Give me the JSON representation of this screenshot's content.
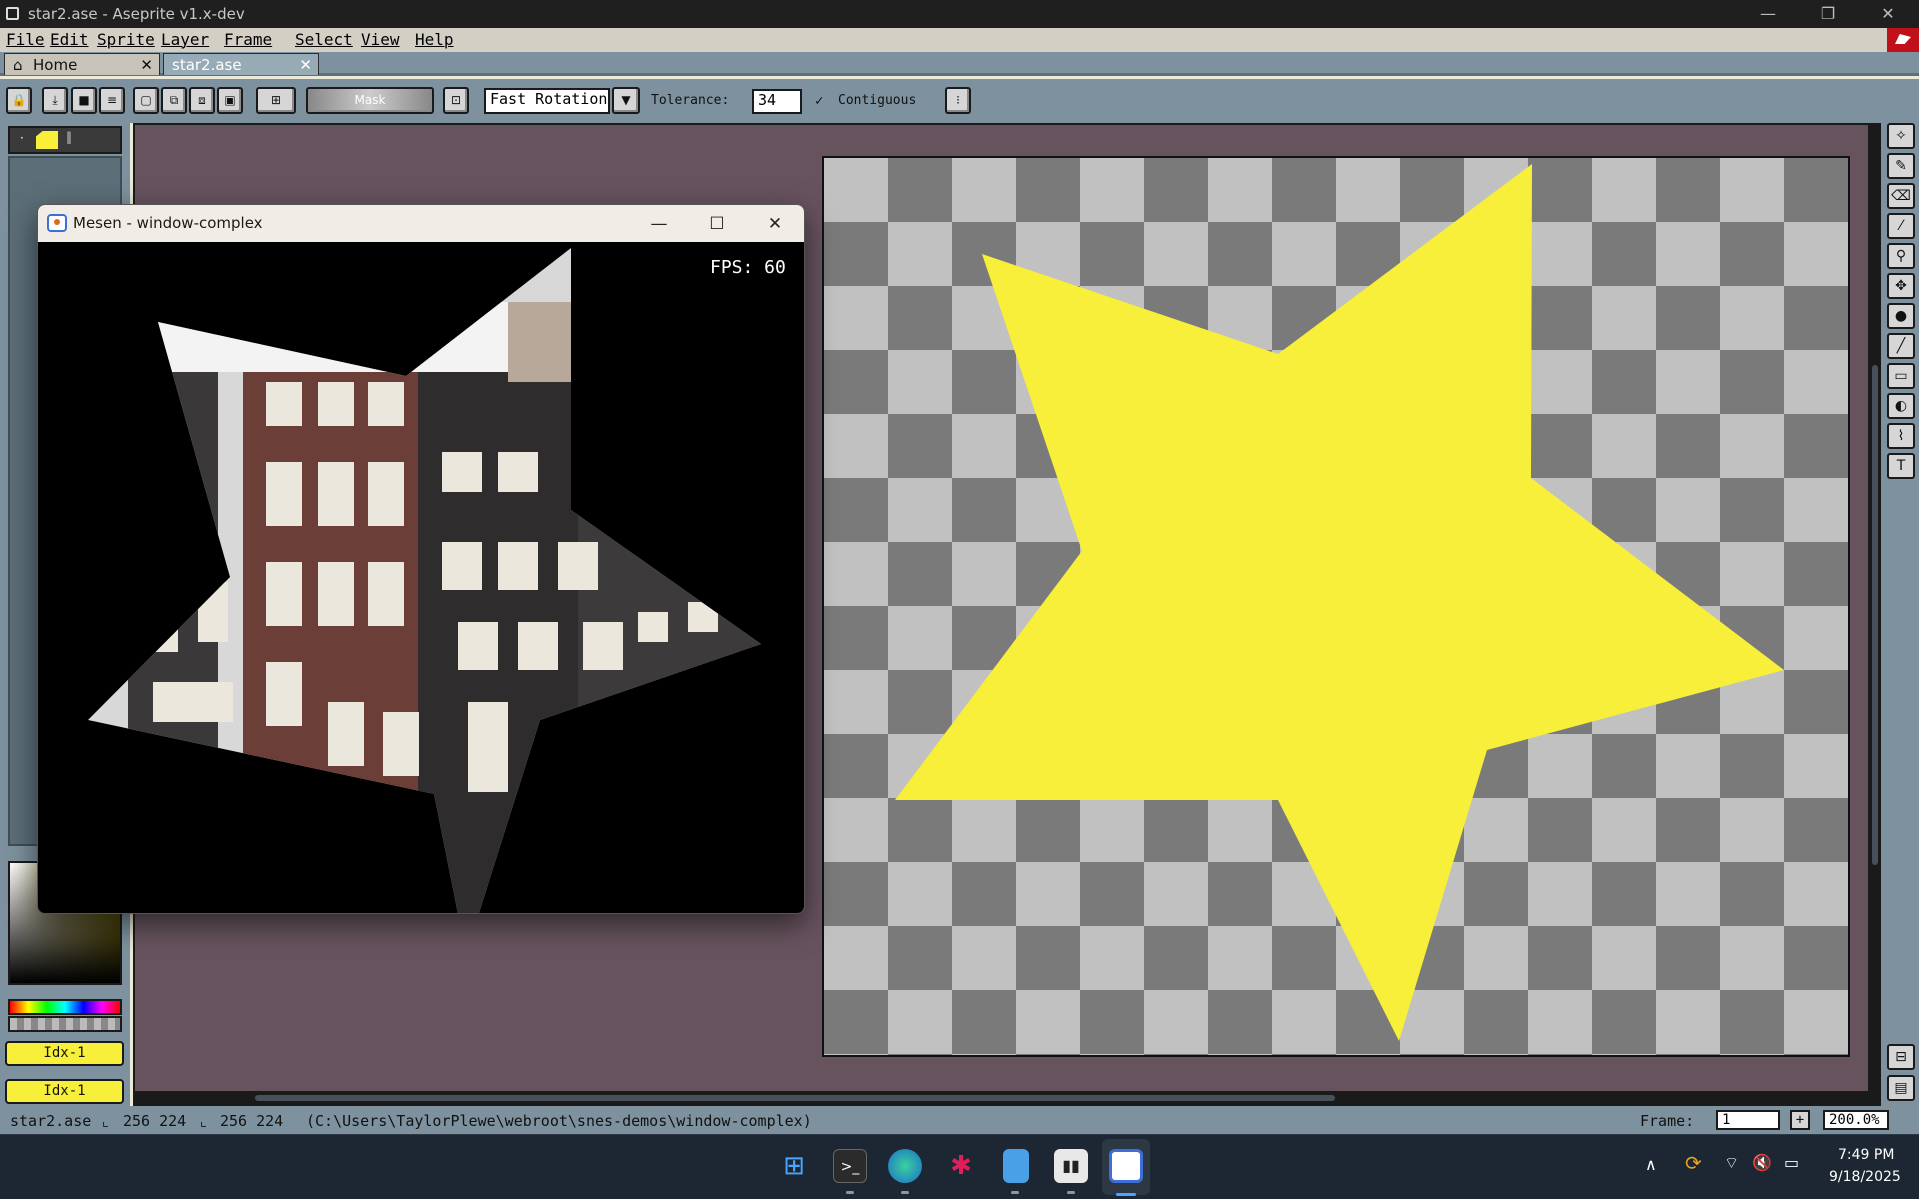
{
  "window": {
    "title": "star2.ase - Aseprite v1.x-dev",
    "minimize": "—",
    "maximize": "❐",
    "close": "✕"
  },
  "menu": {
    "items": [
      "File",
      "Edit",
      "Sprite",
      "Layer",
      "Frame",
      "Select",
      "View",
      "Help"
    ]
  },
  "tabs": [
    {
      "label": "Home",
      "icon": "home-icon",
      "close": "✕",
      "active": false
    },
    {
      "label": "star2.ase",
      "close": "✕",
      "active": true
    }
  ],
  "toolbar": {
    "mask_label": "Mask",
    "rotation_algorithm": "Fast Rotation",
    "tolerance_label": "Tolerance:",
    "tolerance_value": "34",
    "contiguous_label": "Contiguous",
    "contiguous_checked": true
  },
  "palette": {
    "selected_fg": "#f7ef3a",
    "index_buttons": [
      "Idx-1",
      "Idx-1"
    ]
  },
  "canvas": {
    "fill_color": "#f7ef3a",
    "checker_light": "#c1c1c1",
    "checker_dark": "#7a7a7a"
  },
  "statusbar": {
    "file": "star2.ase",
    "size1": "256 224",
    "size2": "256 224",
    "path": "(C:\\Users\\TaylorPlewe\\webroot\\snes-demos\\window-complex)",
    "frame_label": "Frame:",
    "frame_value": "1",
    "zoom": "200.0%"
  },
  "mesen": {
    "title": "Mesen - window-complex",
    "fps": "FPS: 60",
    "minimize": "—",
    "maximize": "☐",
    "close": "✕"
  },
  "taskbar": {
    "time": "7:49 PM",
    "date": "9/18/2025",
    "apps": [
      "windows-start-icon",
      "terminal-icon",
      "edge-icon",
      "slack-icon",
      "notepad-icon",
      "aseprite-icon",
      "mesen-icon"
    ]
  }
}
